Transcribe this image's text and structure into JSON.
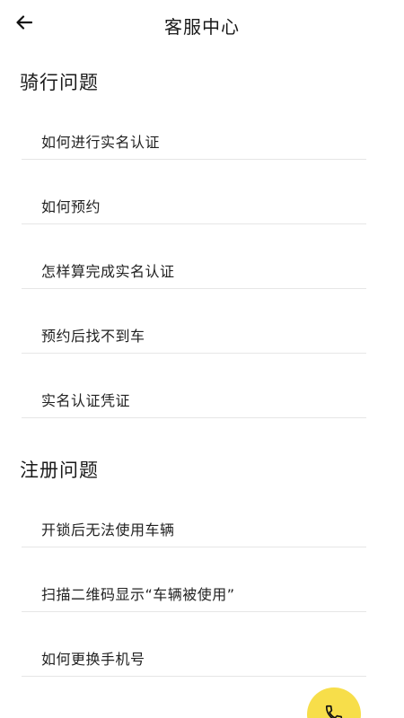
{
  "header": {
    "title": "客服中心",
    "back_icon": "arrow-left-icon"
  },
  "sections": [
    {
      "title": "骑行问题",
      "items": [
        {
          "label": "如何进行实名认证"
        },
        {
          "label": "如何预约"
        },
        {
          "label": "怎样算完成实名认证"
        },
        {
          "label": "预约后找不到车"
        },
        {
          "label": "实名认证凭证"
        }
      ]
    },
    {
      "title": "注册问题",
      "items": [
        {
          "label": "开锁后无法使用车辆"
        },
        {
          "label": "扫描二维码显示“车辆被使用”"
        },
        {
          "label": "如何更换手机号"
        }
      ]
    }
  ],
  "fab": {
    "icon": "phone-icon",
    "color": "#f7de4a"
  }
}
